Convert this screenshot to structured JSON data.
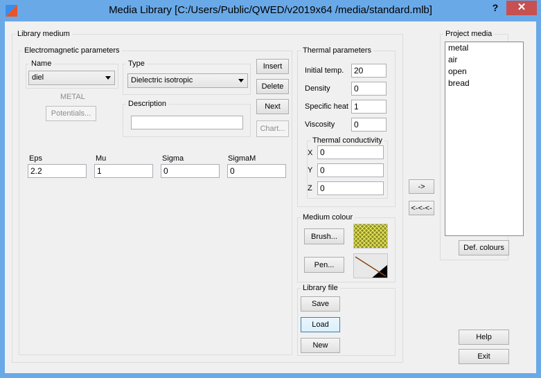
{
  "window": {
    "title": "Media Library [C:/Users/Public/QWED/v2019x64 /media/standard.mlb]",
    "help_label": "?",
    "close_label": "✕"
  },
  "library_medium": {
    "label": "Library medium",
    "electromagnetic": {
      "label": "Electromagnetic parameters",
      "name": {
        "label": "Name",
        "value": "diel"
      },
      "type": {
        "label": "Type",
        "value": "Dielectric isotropic"
      },
      "metal_label": "METAL",
      "potentials_label": "Potentials...",
      "description": {
        "label": "Description",
        "value": ""
      }
    },
    "buttons": {
      "insert": "Insert",
      "delete": "Delete",
      "next": "Next",
      "chart": "Chart..."
    },
    "params": {
      "eps": {
        "label": "Eps",
        "value": "2.2"
      },
      "mu": {
        "label": "Mu",
        "value": "1"
      },
      "sigma": {
        "label": "Sigma",
        "value": "0"
      },
      "sigmam": {
        "label": "SigmaM",
        "value": "0"
      }
    },
    "thermal": {
      "label": "Thermal parameters",
      "initial_temp": {
        "label": "Initial temp.",
        "value": "20"
      },
      "density": {
        "label": "Density",
        "value": "0"
      },
      "specific_heat": {
        "label": "Specific heat",
        "value": "1"
      },
      "viscosity": {
        "label": "Viscosity",
        "value": "0"
      },
      "conductivity": {
        "label": "Thermal conductivity",
        "x": {
          "label": "X",
          "value": "0"
        },
        "y": {
          "label": "Y",
          "value": "0"
        },
        "z": {
          "label": "Z",
          "value": "0"
        }
      }
    },
    "colour": {
      "label": "Medium colour",
      "brush_label": "Brush...",
      "pen_label": "Pen...",
      "brush_color": "#8c8c28",
      "brush_hatch": "#f0f060"
    },
    "library_file": {
      "label": "Library file",
      "save": "Save",
      "load": "Load",
      "new": "New"
    }
  },
  "transfer": {
    "to_project": "->",
    "to_library": "<-<-<-"
  },
  "project_media": {
    "label": "Project media",
    "items": [
      "metal",
      "air",
      "open",
      "bread"
    ],
    "def_colours_label": "Def. colours"
  },
  "footer": {
    "help": "Help",
    "exit": "Exit"
  }
}
